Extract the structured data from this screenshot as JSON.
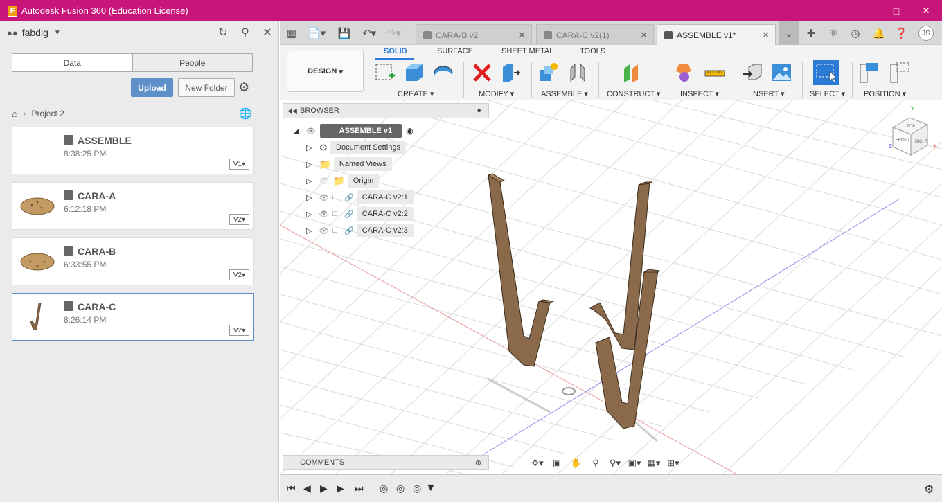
{
  "window": {
    "title": "Autodesk Fusion 360 (Education License)",
    "app_icon": "F"
  },
  "data_panel": {
    "team": "fabdig",
    "tabs": [
      "Data",
      "People"
    ],
    "upload_label": "Upload",
    "new_folder_label": "New Folder",
    "breadcrumb": "Project 2",
    "files": [
      {
        "name": "ASSEMBLE",
        "time": "8:38:25 PM",
        "version": "V1"
      },
      {
        "name": "CARA-A",
        "time": "6:12:18 PM",
        "version": "V2"
      },
      {
        "name": "CARA-B",
        "time": "6:33:55 PM",
        "version": "V2"
      },
      {
        "name": "CARA-C",
        "time": "8:26:14 PM",
        "version": "V2"
      }
    ]
  },
  "document_tabs": [
    {
      "label": "CARA-B v2"
    },
    {
      "label": "CARA-C v2(1)"
    },
    {
      "label": "ASSEMBLE v1*"
    }
  ],
  "toolbar": {
    "user_initials": "JS",
    "workspace": "DESIGN",
    "ribbon_tabs": [
      "SOLID",
      "SURFACE",
      "SHEET METAL",
      "TOOLS"
    ],
    "groups": [
      "CREATE",
      "MODIFY",
      "ASSEMBLE",
      "CONSTRUCT",
      "INSPECT",
      "INSERT",
      "SELECT",
      "POSITION"
    ]
  },
  "browser": {
    "title": "BROWSER",
    "root": "ASSEMBLE v1",
    "items": [
      "Document Settings",
      "Named Views",
      "Origin",
      "CARA-C v2:1",
      "CARA-C v2:2",
      "CARA-C v2:3"
    ]
  },
  "comments": {
    "title": "COMMENTS"
  },
  "viewcube": {
    "top": "TOP",
    "front": "FRONT",
    "right": "RIGHT",
    "axis_y": "Y",
    "axis_x": "X",
    "axis_z": "Z"
  },
  "colors": {
    "titlebar": "#c8157a",
    "accent": "#2b7bd6",
    "wood": "#8a6a4a",
    "upload": "#5d8fc9"
  }
}
